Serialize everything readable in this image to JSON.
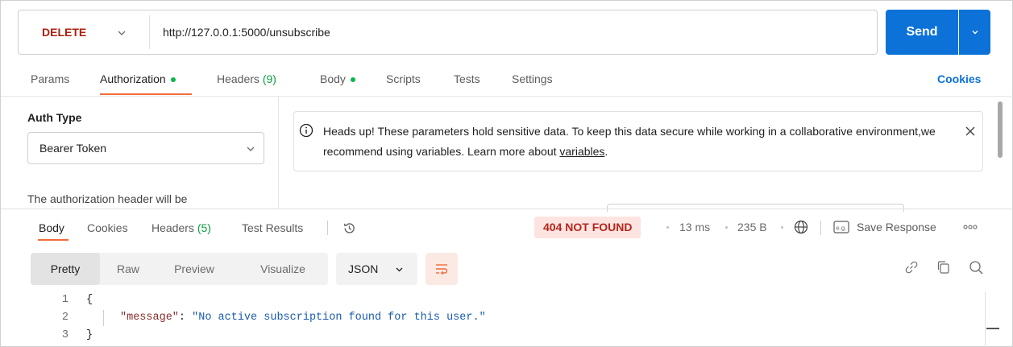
{
  "request": {
    "method": "DELETE",
    "url": "http://127.0.0.1:5000/unsubscribe",
    "send_label": "Send"
  },
  "request_tabs": {
    "params": "Params",
    "authorization": "Authorization",
    "headers": "Headers",
    "headers_count": "(9)",
    "body": "Body",
    "scripts": "Scripts",
    "tests": "Tests",
    "settings": "Settings",
    "cookies": "Cookies"
  },
  "auth": {
    "type_label": "Auth Type",
    "type_value": "Bearer Token",
    "description": "The authorization header will be",
    "notice_text": "Heads up! These parameters hold sensitive data. To keep this data secure while working in a collaborative environment,we recommend using variables. Learn more about ",
    "notice_link": "variables",
    "notice_end": "."
  },
  "response_tabs": {
    "body": "Body",
    "cookies": "Cookies",
    "headers": "Headers",
    "headers_count": "(5)",
    "test_results": "Test Results"
  },
  "response_meta": {
    "status": "404 NOT FOUND",
    "time": "13 ms",
    "size": "235 B",
    "save_label": "Save Response"
  },
  "response_toolbar": {
    "pretty": "Pretty",
    "raw": "Raw",
    "preview": "Preview",
    "visualize": "Visualize",
    "format": "JSON"
  },
  "code": {
    "line_numbers": [
      "1",
      "2",
      "3"
    ],
    "open_brace": "{",
    "key": "\"message\"",
    "colon": ": ",
    "value": "\"No active subscription found for this user.\"",
    "close_brace": "}"
  },
  "colors": {
    "method": "#ad1e0e",
    "send": "#0c72d8",
    "accent_underline": "#f26b3a",
    "status_bg": "#fde4e0",
    "status_text": "#b3261e",
    "success_dot": "#0cb44c"
  },
  "icons": {
    "method_dropdown": "chevron-down-icon",
    "send_dropdown": "chevron-down-icon",
    "notice": "info-icon",
    "notice_close": "close-icon",
    "history": "history-icon",
    "network": "globe-icon",
    "save": "example-icon",
    "more": "more-icon",
    "wrap": "wrap-lines-icon",
    "link": "link-icon",
    "copy": "copy-icon",
    "search": "search-icon"
  }
}
